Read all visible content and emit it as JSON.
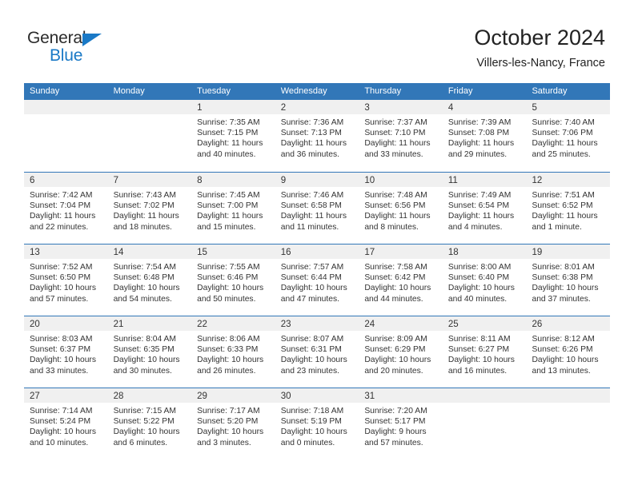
{
  "brand": {
    "name_part1": "General",
    "name_part2": "Blue",
    "triangle_color": "#1A79C6",
    "text_color": "#2B2B2B"
  },
  "header": {
    "title": "October 2024",
    "subtitle": "Villers-les-Nancy, France"
  },
  "theme": {
    "header_blue": "#3277B8",
    "date_band_gray": "#F0F0F0",
    "text": "#333333"
  },
  "weekdays": [
    "Sunday",
    "Monday",
    "Tuesday",
    "Wednesday",
    "Thursday",
    "Friday",
    "Saturday"
  ],
  "weeks": [
    [
      {
        "day": "",
        "sunrise": "",
        "sunset": "",
        "daylight1": "",
        "daylight2": ""
      },
      {
        "day": "",
        "sunrise": "",
        "sunset": "",
        "daylight1": "",
        "daylight2": ""
      },
      {
        "day": "1",
        "sunrise": "Sunrise: 7:35 AM",
        "sunset": "Sunset: 7:15 PM",
        "daylight1": "Daylight: 11 hours",
        "daylight2": "and 40 minutes."
      },
      {
        "day": "2",
        "sunrise": "Sunrise: 7:36 AM",
        "sunset": "Sunset: 7:13 PM",
        "daylight1": "Daylight: 11 hours",
        "daylight2": "and 36 minutes."
      },
      {
        "day": "3",
        "sunrise": "Sunrise: 7:37 AM",
        "sunset": "Sunset: 7:10 PM",
        "daylight1": "Daylight: 11 hours",
        "daylight2": "and 33 minutes."
      },
      {
        "day": "4",
        "sunrise": "Sunrise: 7:39 AM",
        "sunset": "Sunset: 7:08 PM",
        "daylight1": "Daylight: 11 hours",
        "daylight2": "and 29 minutes."
      },
      {
        "day": "5",
        "sunrise": "Sunrise: 7:40 AM",
        "sunset": "Sunset: 7:06 PM",
        "daylight1": "Daylight: 11 hours",
        "daylight2": "and 25 minutes."
      }
    ],
    [
      {
        "day": "6",
        "sunrise": "Sunrise: 7:42 AM",
        "sunset": "Sunset: 7:04 PM",
        "daylight1": "Daylight: 11 hours",
        "daylight2": "and 22 minutes."
      },
      {
        "day": "7",
        "sunrise": "Sunrise: 7:43 AM",
        "sunset": "Sunset: 7:02 PM",
        "daylight1": "Daylight: 11 hours",
        "daylight2": "and 18 minutes."
      },
      {
        "day": "8",
        "sunrise": "Sunrise: 7:45 AM",
        "sunset": "Sunset: 7:00 PM",
        "daylight1": "Daylight: 11 hours",
        "daylight2": "and 15 minutes."
      },
      {
        "day": "9",
        "sunrise": "Sunrise: 7:46 AM",
        "sunset": "Sunset: 6:58 PM",
        "daylight1": "Daylight: 11 hours",
        "daylight2": "and 11 minutes."
      },
      {
        "day": "10",
        "sunrise": "Sunrise: 7:48 AM",
        "sunset": "Sunset: 6:56 PM",
        "daylight1": "Daylight: 11 hours",
        "daylight2": "and 8 minutes."
      },
      {
        "day": "11",
        "sunrise": "Sunrise: 7:49 AM",
        "sunset": "Sunset: 6:54 PM",
        "daylight1": "Daylight: 11 hours",
        "daylight2": "and 4 minutes."
      },
      {
        "day": "12",
        "sunrise": "Sunrise: 7:51 AM",
        "sunset": "Sunset: 6:52 PM",
        "daylight1": "Daylight: 11 hours",
        "daylight2": "and 1 minute."
      }
    ],
    [
      {
        "day": "13",
        "sunrise": "Sunrise: 7:52 AM",
        "sunset": "Sunset: 6:50 PM",
        "daylight1": "Daylight: 10 hours",
        "daylight2": "and 57 minutes."
      },
      {
        "day": "14",
        "sunrise": "Sunrise: 7:54 AM",
        "sunset": "Sunset: 6:48 PM",
        "daylight1": "Daylight: 10 hours",
        "daylight2": "and 54 minutes."
      },
      {
        "day": "15",
        "sunrise": "Sunrise: 7:55 AM",
        "sunset": "Sunset: 6:46 PM",
        "daylight1": "Daylight: 10 hours",
        "daylight2": "and 50 minutes."
      },
      {
        "day": "16",
        "sunrise": "Sunrise: 7:57 AM",
        "sunset": "Sunset: 6:44 PM",
        "daylight1": "Daylight: 10 hours",
        "daylight2": "and 47 minutes."
      },
      {
        "day": "17",
        "sunrise": "Sunrise: 7:58 AM",
        "sunset": "Sunset: 6:42 PM",
        "daylight1": "Daylight: 10 hours",
        "daylight2": "and 44 minutes."
      },
      {
        "day": "18",
        "sunrise": "Sunrise: 8:00 AM",
        "sunset": "Sunset: 6:40 PM",
        "daylight1": "Daylight: 10 hours",
        "daylight2": "and 40 minutes."
      },
      {
        "day": "19",
        "sunrise": "Sunrise: 8:01 AM",
        "sunset": "Sunset: 6:38 PM",
        "daylight1": "Daylight: 10 hours",
        "daylight2": "and 37 minutes."
      }
    ],
    [
      {
        "day": "20",
        "sunrise": "Sunrise: 8:03 AM",
        "sunset": "Sunset: 6:37 PM",
        "daylight1": "Daylight: 10 hours",
        "daylight2": "and 33 minutes."
      },
      {
        "day": "21",
        "sunrise": "Sunrise: 8:04 AM",
        "sunset": "Sunset: 6:35 PM",
        "daylight1": "Daylight: 10 hours",
        "daylight2": "and 30 minutes."
      },
      {
        "day": "22",
        "sunrise": "Sunrise: 8:06 AM",
        "sunset": "Sunset: 6:33 PM",
        "daylight1": "Daylight: 10 hours",
        "daylight2": "and 26 minutes."
      },
      {
        "day": "23",
        "sunrise": "Sunrise: 8:07 AM",
        "sunset": "Sunset: 6:31 PM",
        "daylight1": "Daylight: 10 hours",
        "daylight2": "and 23 minutes."
      },
      {
        "day": "24",
        "sunrise": "Sunrise: 8:09 AM",
        "sunset": "Sunset: 6:29 PM",
        "daylight1": "Daylight: 10 hours",
        "daylight2": "and 20 minutes."
      },
      {
        "day": "25",
        "sunrise": "Sunrise: 8:11 AM",
        "sunset": "Sunset: 6:27 PM",
        "daylight1": "Daylight: 10 hours",
        "daylight2": "and 16 minutes."
      },
      {
        "day": "26",
        "sunrise": "Sunrise: 8:12 AM",
        "sunset": "Sunset: 6:26 PM",
        "daylight1": "Daylight: 10 hours",
        "daylight2": "and 13 minutes."
      }
    ],
    [
      {
        "day": "27",
        "sunrise": "Sunrise: 7:14 AM",
        "sunset": "Sunset: 5:24 PM",
        "daylight1": "Daylight: 10 hours",
        "daylight2": "and 10 minutes."
      },
      {
        "day": "28",
        "sunrise": "Sunrise: 7:15 AM",
        "sunset": "Sunset: 5:22 PM",
        "daylight1": "Daylight: 10 hours",
        "daylight2": "and 6 minutes."
      },
      {
        "day": "29",
        "sunrise": "Sunrise: 7:17 AM",
        "sunset": "Sunset: 5:20 PM",
        "daylight1": "Daylight: 10 hours",
        "daylight2": "and 3 minutes."
      },
      {
        "day": "30",
        "sunrise": "Sunrise: 7:18 AM",
        "sunset": "Sunset: 5:19 PM",
        "daylight1": "Daylight: 10 hours",
        "daylight2": "and 0 minutes."
      },
      {
        "day": "31",
        "sunrise": "Sunrise: 7:20 AM",
        "sunset": "Sunset: 5:17 PM",
        "daylight1": "Daylight: 9 hours",
        "daylight2": "and 57 minutes."
      },
      {
        "day": "",
        "sunrise": "",
        "sunset": "",
        "daylight1": "",
        "daylight2": ""
      },
      {
        "day": "",
        "sunrise": "",
        "sunset": "",
        "daylight1": "",
        "daylight2": ""
      }
    ]
  ]
}
